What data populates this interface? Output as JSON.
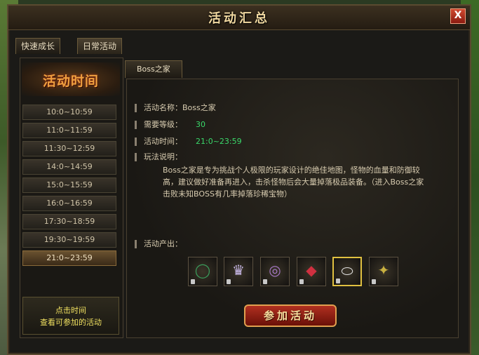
{
  "window": {
    "title": "活动汇总",
    "close_label": "X"
  },
  "tabs": [
    "快速成长",
    "日常活动"
  ],
  "left": {
    "banner": "活动时间",
    "times": [
      "10:0~10:59",
      "11:0~11:59",
      "11:30~12:59",
      "14:0~14:59",
      "15:0~15:59",
      "16:0~16:59",
      "17:30~18:59",
      "19:30~19:59",
      "21:0~23:59"
    ],
    "active_index": 8,
    "hint_line1": "点击时间",
    "hint_line2": "查看可参加的活动"
  },
  "subtab": "Boss之家",
  "info": {
    "name_label": "活动名称：",
    "name_value": "Boss之家",
    "level_label": "需要等级：",
    "level_value": "30",
    "time_label": "活动时间：",
    "time_value": "21:0~23:59",
    "desc_label": "玩法说明：",
    "desc_text": "Boss之家是专为挑战个人极限的玩家设计的绝佳地图，怪物的血量和防御较高，建议做好准备再进入，击杀怪物后会大量掉落极品装备。（进入Boss之家击败未知BOSS有几率掉落珍稀宝物）",
    "output_label": "活动产出："
  },
  "items": [
    {
      "name": "necklace-icon",
      "glyph": "◯",
      "color": "#3a9a5a"
    },
    {
      "name": "crown-icon",
      "glyph": "♛",
      "color": "#c8b8e8"
    },
    {
      "name": "bracelet-icon",
      "glyph": "◎",
      "color": "#a878c8"
    },
    {
      "name": "gem-ring-icon",
      "glyph": "◆",
      "color": "#d03040"
    },
    {
      "name": "silver-ring-icon",
      "glyph": "⬭",
      "color": "#e0e0e0"
    },
    {
      "name": "ornament-icon",
      "glyph": "✦",
      "color": "#c8b040"
    }
  ],
  "selected_item": 4,
  "join_button": "参加活动",
  "colors": {
    "green_value": "#3ad86a",
    "accent_gold": "#e0c040"
  }
}
